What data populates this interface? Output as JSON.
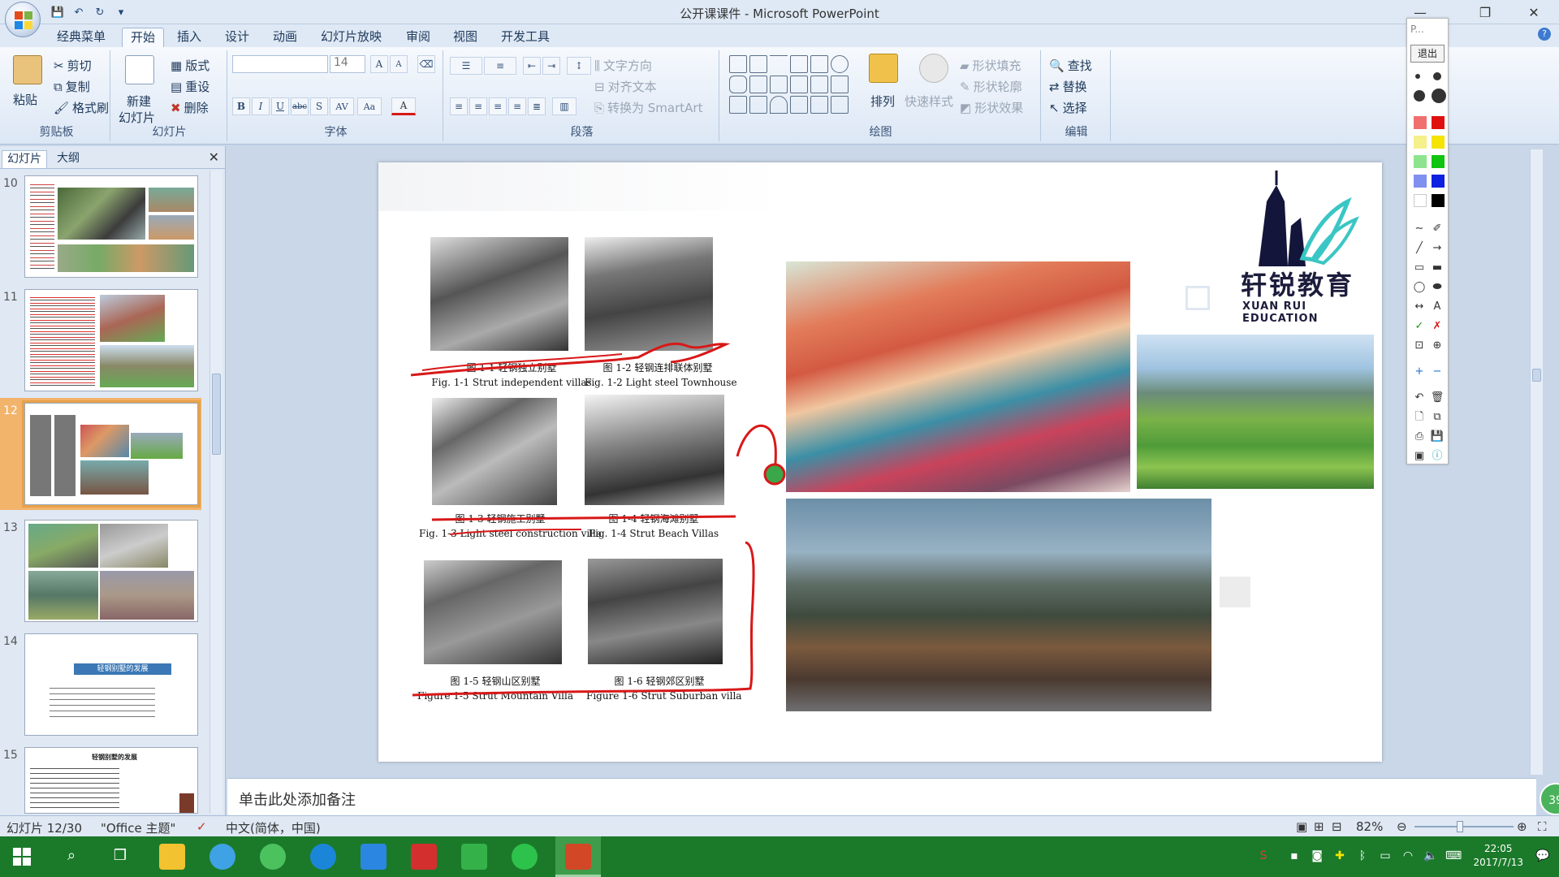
{
  "window": {
    "title": "公开课课件 - Microsoft PowerPoint",
    "minimize": "—",
    "restore": "❐",
    "close": "✕"
  },
  "qat": {
    "save": "💾",
    "undo": "↶",
    "redo": "↻",
    "more": "▾"
  },
  "tabs": [
    "经典菜单",
    "开始",
    "插入",
    "设计",
    "动画",
    "幻灯片放映",
    "审阅",
    "视图",
    "开发工具"
  ],
  "active_tab": "开始",
  "ribbon": {
    "clipboard": {
      "paste": "粘贴",
      "cut": "剪切",
      "copy": "复制",
      "format_painter": "格式刷",
      "label": "剪贴板"
    },
    "slides": {
      "new_slide": "新建",
      "new_slide2": "幻灯片",
      "layout": "版式",
      "reset": "重设",
      "delete": "删除",
      "label": "幻灯片"
    },
    "font": {
      "font_size": "14",
      "bold": "B",
      "italic": "I",
      "underline": "U",
      "strike": "abc",
      "shadow": "S",
      "spacing": "AV",
      "case": "Aa",
      "color": "A",
      "grow": "A",
      "shrink": "A",
      "label": "字体"
    },
    "paragraph": {
      "text_direction": "文字方向",
      "align_text": "对齐文本",
      "smartart": "转换为 SmartArt",
      "label": "段落"
    },
    "drawing": {
      "arrange": "排列",
      "quick_styles": "快速样式",
      "shape_fill": "形状填充",
      "shape_outline": "形状轮廓",
      "shape_effects": "形状效果",
      "label": "绘图"
    },
    "editing": {
      "find": "查找",
      "replace": "替换",
      "select": "选择",
      "label": "编辑"
    }
  },
  "left_pane": {
    "tab_slides": "幻灯片",
    "tab_outline": "大纲",
    "close": "✕",
    "thumbnails": [
      {
        "num": "10"
      },
      {
        "num": "11"
      },
      {
        "num": "12",
        "selected": true
      },
      {
        "num": "13"
      },
      {
        "num": "14",
        "title": "轻钢别墅的发展"
      },
      {
        "num": "15",
        "title": "轻钢别墅的发展"
      }
    ]
  },
  "slide": {
    "captions": [
      {
        "cn": "图 1-1 轻钢独立别墅",
        "en": "Fig. 1-1 Strut independent villas"
      },
      {
        "cn": "图 1-2 轻钢连排联体别墅",
        "en": "Fig. 1-2 Light steel Townhouse"
      },
      {
        "cn": "图 1-3 轻钢施工别墅",
        "en": "Fig. 1-3 Light steel construction villa"
      },
      {
        "cn": "图 1-4 轻钢海滩别墅",
        "en": "Fig. 1-4 Strut Beach Villas"
      },
      {
        "cn": "图 1-5 轻钢山区别墅",
        "en": "Figure 1-5 Strut Mountain Villa"
      },
      {
        "cn": "图 1-6 轻钢郊区别墅",
        "en": "Figure 1-6 Strut Suburban villa"
      }
    ],
    "logo_cn": "轩锐教育",
    "logo_en": "XUAN RUI EDUCATION"
  },
  "notes_placeholder": "单击此处添加备注",
  "pen_toolbar": {
    "exit": "退出",
    "title": "P..."
  },
  "statusbar": {
    "slide_pos": "幻灯片 12/30",
    "theme": "\"Office 主题\"",
    "language": "中文(简体，中国)",
    "zoom": "82%",
    "timer": "39"
  },
  "clock": {
    "time": "22:05",
    "date": "2017/7/13"
  },
  "colors": {
    "accent": "#1b7a2a",
    "selection": "#f2b36b",
    "ribbon": "#dfe9f5",
    "ink": "#d81818"
  }
}
